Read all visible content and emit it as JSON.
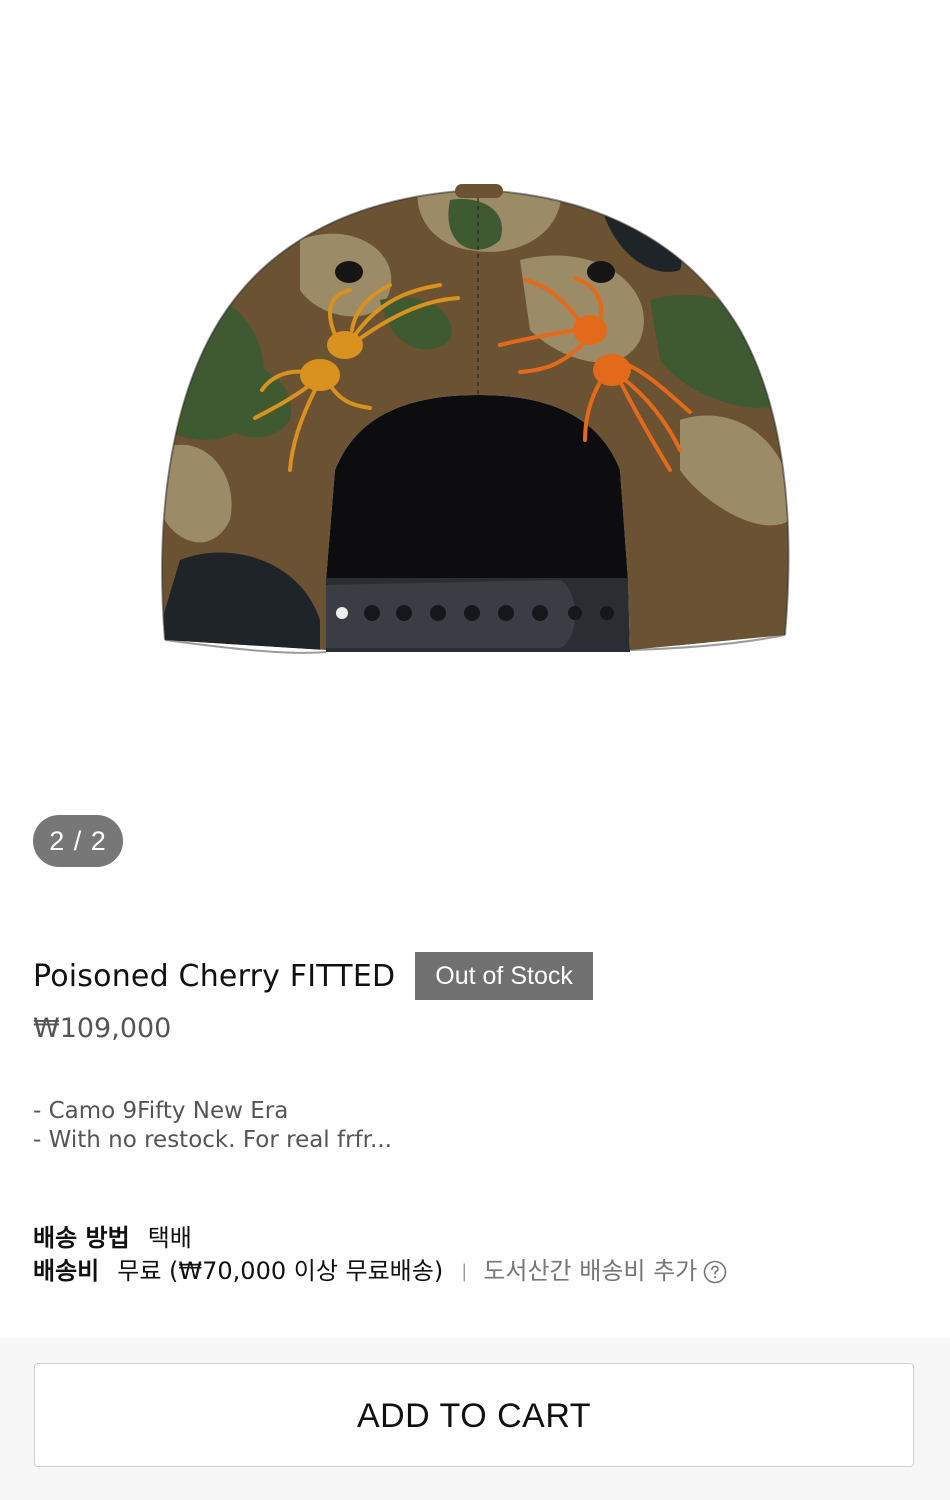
{
  "gallery": {
    "counter": "2 / 2",
    "image_alt": "Camo snapback cap with embroidered spiders, back view"
  },
  "product": {
    "title": "Poisoned Cherry FITTED",
    "stock_status": "Out of Stock",
    "price": "₩109,000",
    "description": [
      "- Camo 9Fifty New Era",
      "- With no restock. For real frfr..."
    ]
  },
  "shipping": {
    "method_label": "배송 방법",
    "method_value": "택배",
    "fee_label": "배송비",
    "fee_value": "무료 (₩70,000 이상 무료배송)",
    "separator": "|",
    "extra_note": "도서산간 배송비 추가",
    "help_icon": "question-circle-icon"
  },
  "actions": {
    "add_to_cart_label": "ADD TO CART"
  },
  "colors": {
    "badge_bg": "#707070",
    "counter_bg": "#777777",
    "camo_brown": "#6b5232",
    "camo_green": "#3f5a31",
    "camo_tan": "#9c8b67",
    "spider_left": "#d9911f",
    "spider_right": "#e46a1b"
  }
}
